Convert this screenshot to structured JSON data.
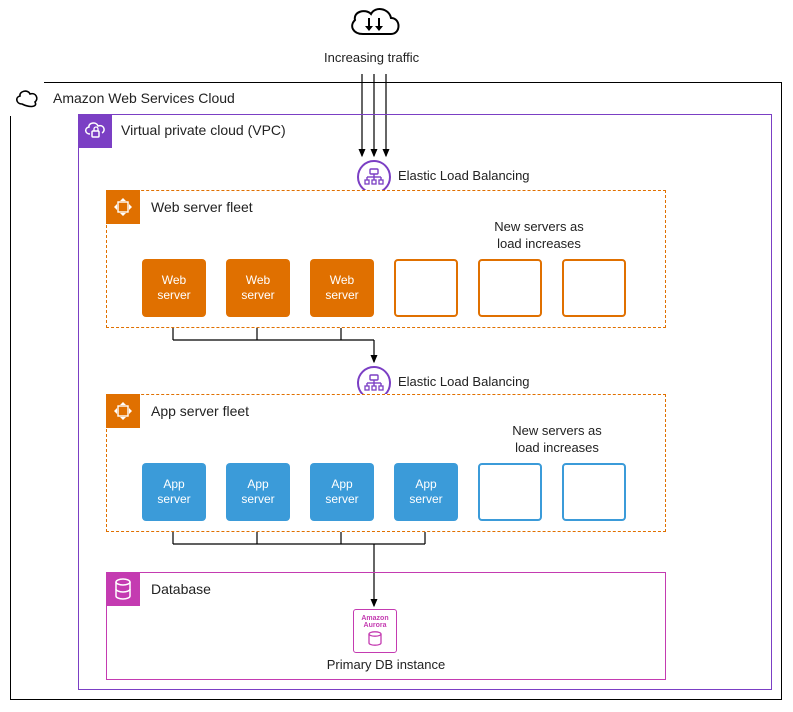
{
  "top": {
    "traffic_label": "Increasing traffic"
  },
  "aws": {
    "title": "Amazon Web Services Cloud"
  },
  "vpc": {
    "title": "Virtual private cloud (VPC)"
  },
  "elb1": {
    "label": "Elastic Load Balancing"
  },
  "web_fleet": {
    "title": "Web server fleet",
    "note": "New servers as\nload increases",
    "servers": [
      {
        "label": "Web\nserver"
      },
      {
        "label": "Web\nserver"
      },
      {
        "label": "Web\nserver"
      }
    ],
    "empty_count": 3
  },
  "elb2": {
    "label": "Elastic Load Balancing"
  },
  "app_fleet": {
    "title": "App server fleet",
    "note": "New servers as\nload increases",
    "servers": [
      {
        "label": "App\nserver"
      },
      {
        "label": "App\nserver"
      },
      {
        "label": "App\nserver"
      },
      {
        "label": "App\nserver"
      }
    ],
    "empty_count": 2
  },
  "db": {
    "title": "Database",
    "aurora_label": "Amazon\nAurora",
    "primary_label": "Primary DB instance"
  },
  "colors": {
    "orange": "#e07000",
    "blue": "#3b9bd9",
    "purple": "#7b3fc4",
    "magenta": "#c43bb1"
  }
}
